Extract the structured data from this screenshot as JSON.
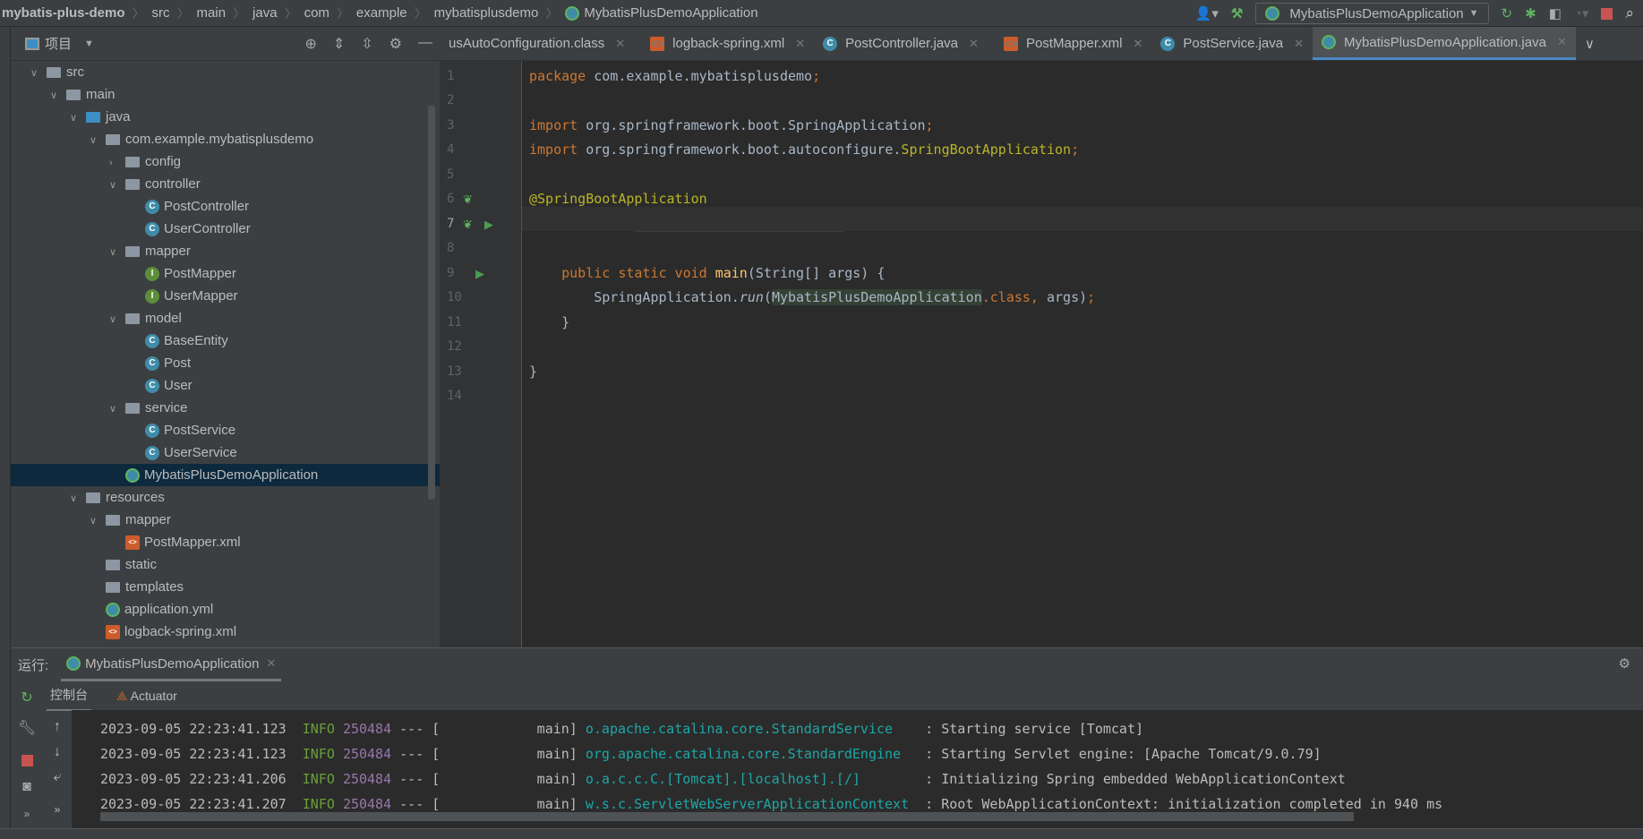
{
  "breadcrumb": [
    "mybatis-plus-demo",
    "src",
    "main",
    "java",
    "com",
    "example",
    "mybatisplusdemo",
    "MybatisPlusDemoApplication"
  ],
  "toolbar": {
    "run_config": "MybatisPlusDemoApplication",
    "icons": [
      "user-icon",
      "hammer-icon",
      "rerun-icon",
      "debug-icon",
      "coverage-icon",
      "profile-icon",
      "stop-icon",
      "search-icon"
    ]
  },
  "project": {
    "title": "项目",
    "tree": [
      {
        "label": "src",
        "depth": 1,
        "type": "folder",
        "open": true
      },
      {
        "label": "main",
        "depth": 2,
        "type": "folder",
        "open": true
      },
      {
        "label": "java",
        "depth": 3,
        "type": "folder-blue",
        "open": true
      },
      {
        "label": "com.example.mybatisplusdemo",
        "depth": 4,
        "type": "package",
        "open": true
      },
      {
        "label": "config",
        "depth": 5,
        "type": "package",
        "open": false
      },
      {
        "label": "controller",
        "depth": 5,
        "type": "package",
        "open": true
      },
      {
        "label": "PostController",
        "depth": 6,
        "type": "class"
      },
      {
        "label": "UserController",
        "depth": 6,
        "type": "class"
      },
      {
        "label": "mapper",
        "depth": 5,
        "type": "package",
        "open": true
      },
      {
        "label": "PostMapper",
        "depth": 6,
        "type": "interface"
      },
      {
        "label": "UserMapper",
        "depth": 6,
        "type": "interface"
      },
      {
        "label": "model",
        "depth": 5,
        "type": "package",
        "open": true
      },
      {
        "label": "BaseEntity",
        "depth": 6,
        "type": "class"
      },
      {
        "label": "Post",
        "depth": 6,
        "type": "class"
      },
      {
        "label": "User",
        "depth": 6,
        "type": "class"
      },
      {
        "label": "service",
        "depth": 5,
        "type": "package",
        "open": true
      },
      {
        "label": "PostService",
        "depth": 6,
        "type": "class"
      },
      {
        "label": "UserService",
        "depth": 6,
        "type": "class"
      },
      {
        "label": "MybatisPlusDemoApplication",
        "depth": 5,
        "type": "spring",
        "selected": true
      },
      {
        "label": "resources",
        "depth": 3,
        "type": "folder",
        "open": true
      },
      {
        "label": "mapper",
        "depth": 4,
        "type": "folder",
        "open": true
      },
      {
        "label": "PostMapper.xml",
        "depth": 5,
        "type": "xml"
      },
      {
        "label": "static",
        "depth": 4,
        "type": "folder"
      },
      {
        "label": "templates",
        "depth": 4,
        "type": "folder"
      },
      {
        "label": "application.yml",
        "depth": 4,
        "type": "spring"
      },
      {
        "label": "logback-spring.xml",
        "depth": 4,
        "type": "xml"
      }
    ]
  },
  "tabs": [
    {
      "label": "usAutoConfiguration.class",
      "type": "none"
    },
    {
      "label": "logback-spring.xml",
      "type": "xml"
    },
    {
      "label": "PostController.java",
      "type": "class"
    },
    {
      "label": "PostMapper.xml",
      "type": "xml"
    },
    {
      "label": "PostService.java",
      "type": "class"
    },
    {
      "label": "MybatisPlusDemoApplication.java",
      "type": "spring",
      "active": true
    }
  ],
  "code": {
    "line_numbers": [
      "1",
      "2",
      "3",
      "4",
      "5",
      "6",
      "7",
      "8",
      "9",
      "10",
      "11",
      "12",
      "13",
      "14"
    ]
  },
  "run": {
    "label": "运行:",
    "tab": "MybatisPlusDemoApplication",
    "console_tab": "控制台",
    "actuator_tab": "Actuator",
    "logs": [
      {
        "ts": "2023-09-05 22:23:41.123",
        "level": "INFO",
        "pid": "250484",
        "sep": "--- [",
        "thread": "           main]",
        "logger": "o.apache.catalina.core.StandardService   ",
        "msg": ": Starting service [Tomcat]"
      },
      {
        "ts": "2023-09-05 22:23:41.123",
        "level": "INFO",
        "pid": "250484",
        "sep": "--- [",
        "thread": "           main]",
        "logger": "org.apache.catalina.core.StandardEngine  ",
        "msg": ": Starting Servlet engine: [Apache Tomcat/9.0.79]"
      },
      {
        "ts": "2023-09-05 22:23:41.206",
        "level": "INFO",
        "pid": "250484",
        "sep": "--- [",
        "thread": "           main]",
        "logger": "o.a.c.c.C.[Tomcat].[localhost].[/]       ",
        "msg": ": Initializing Spring embedded WebApplicationContext"
      },
      {
        "ts": "2023-09-05 22:23:41.207",
        "level": "INFO",
        "pid": "250484",
        "sep": "--- [",
        "thread": "           main]",
        "logger": "w.s.c.ServletWebServerApplicationContext ",
        "msg": ": Root WebApplicationContext: initialization completed in 940 ms"
      }
    ]
  }
}
